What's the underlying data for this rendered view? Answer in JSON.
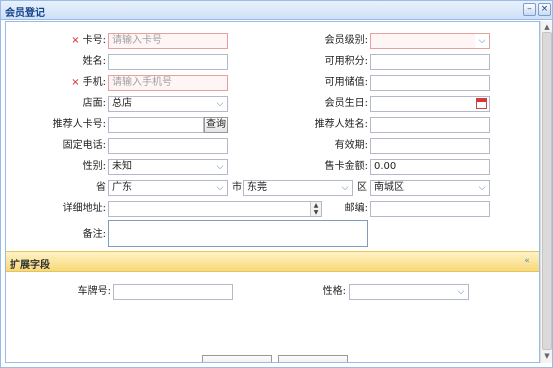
{
  "window": {
    "title": "会员登记",
    "buttons": {
      "collapse_icon": "minimize-icon",
      "close_icon": "close-icon",
      "collapse_glyph": "–",
      "close_glyph": "×"
    }
  },
  "form": {
    "required_mark": "×",
    "card_no": {
      "label": "卡号:",
      "placeholder": "请输入卡号"
    },
    "member_level": {
      "label": "会员级别:",
      "value": ""
    },
    "name": {
      "label": "姓名:",
      "value": ""
    },
    "available_points": {
      "label": "可用积分:",
      "value": ""
    },
    "mobile": {
      "label": "手机:",
      "placeholder": "请输入手机号"
    },
    "available_balance": {
      "label": "可用储值:",
      "value": ""
    },
    "store": {
      "label": "店面:",
      "value": "总店"
    },
    "birthday": {
      "label": "会员生日:",
      "value": ""
    },
    "referrer_card": {
      "label": "推荐人卡号:",
      "value": "",
      "button": "查询"
    },
    "referrer_name": {
      "label": "推荐人姓名:",
      "value": ""
    },
    "landline": {
      "label": "固定电话:",
      "value": ""
    },
    "validity": {
      "label": "有效期:",
      "value": ""
    },
    "gender": {
      "label": "性别:",
      "value": "未知"
    },
    "card_price": {
      "label": "售卡金额:",
      "value": "0.00"
    },
    "province": {
      "label": "省",
      "value": "广东"
    },
    "city": {
      "label": "市",
      "value": "东莞"
    },
    "district": {
      "label": "区",
      "value": "南城区"
    },
    "address": {
      "label": "详细地址:",
      "value": ""
    },
    "postcode": {
      "label": "邮编:",
      "value": ""
    },
    "remark": {
      "label": "备注:",
      "value": ""
    }
  },
  "extension": {
    "title": "扩展字段",
    "collapse_glyph": "«",
    "plate_no": {
      "label": "车牌号:",
      "value": ""
    },
    "character": {
      "label": "性格:",
      "value": ""
    }
  },
  "icons": {
    "dropdown_glyph": "⌵",
    "spin_up": "▲",
    "spin_down": "▼",
    "scroll_up": "▲",
    "scroll_down": "▼"
  },
  "colors": {
    "title_text": "#15428b",
    "required": "#e02020",
    "section_bg": "#f7d97a",
    "border": "#99bbe8"
  }
}
